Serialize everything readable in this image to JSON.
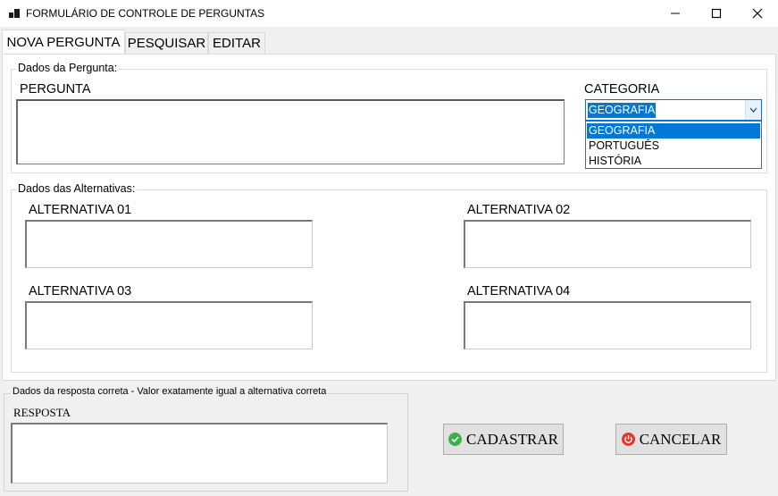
{
  "window": {
    "title": "FORMULÁRIO DE CONTROLE DE PERGUNTAS",
    "controls": [
      "minimize-icon",
      "maximize-icon",
      "close-icon"
    ]
  },
  "tabs": [
    {
      "label": "NOVA PERGUNTA",
      "active": true
    },
    {
      "label": "PESQUISAR",
      "active": false
    },
    {
      "label": "EDITAR",
      "active": false
    }
  ],
  "question_group": {
    "title": "Dados da Pergunta:",
    "question_label": "PERGUNTA",
    "question_value": "",
    "category_label": "CATEGORIA",
    "category_selected": "GEOGRAFIA",
    "category_options": [
      "GEOGRAFIA",
      "PORTUGUÊS",
      "HISTÓRIA"
    ]
  },
  "alternatives_group": {
    "title": "Dados das Alternativas:",
    "alt1_label": "ALTERNATIVA 01",
    "alt2_label": "ALTERNATIVA 02",
    "alt3_label": "ALTERNATIVA 03",
    "alt4_label": "ALTERNATIVA 04"
  },
  "answer_group": {
    "title": "Dados da resposta correta - Valor exatamente igual a alternativa correta",
    "answer_label": "RESPOSTA",
    "answer_value": ""
  },
  "buttons": {
    "register_label": "CADASTRAR",
    "register_icon": "check-circle-icon",
    "cancel_label": "CANCELAR",
    "cancel_icon": "power-icon"
  },
  "colors": {
    "selection": "#0078d7",
    "register_icon": "#3cb04a",
    "cancel_icon": "#e03a2f"
  }
}
